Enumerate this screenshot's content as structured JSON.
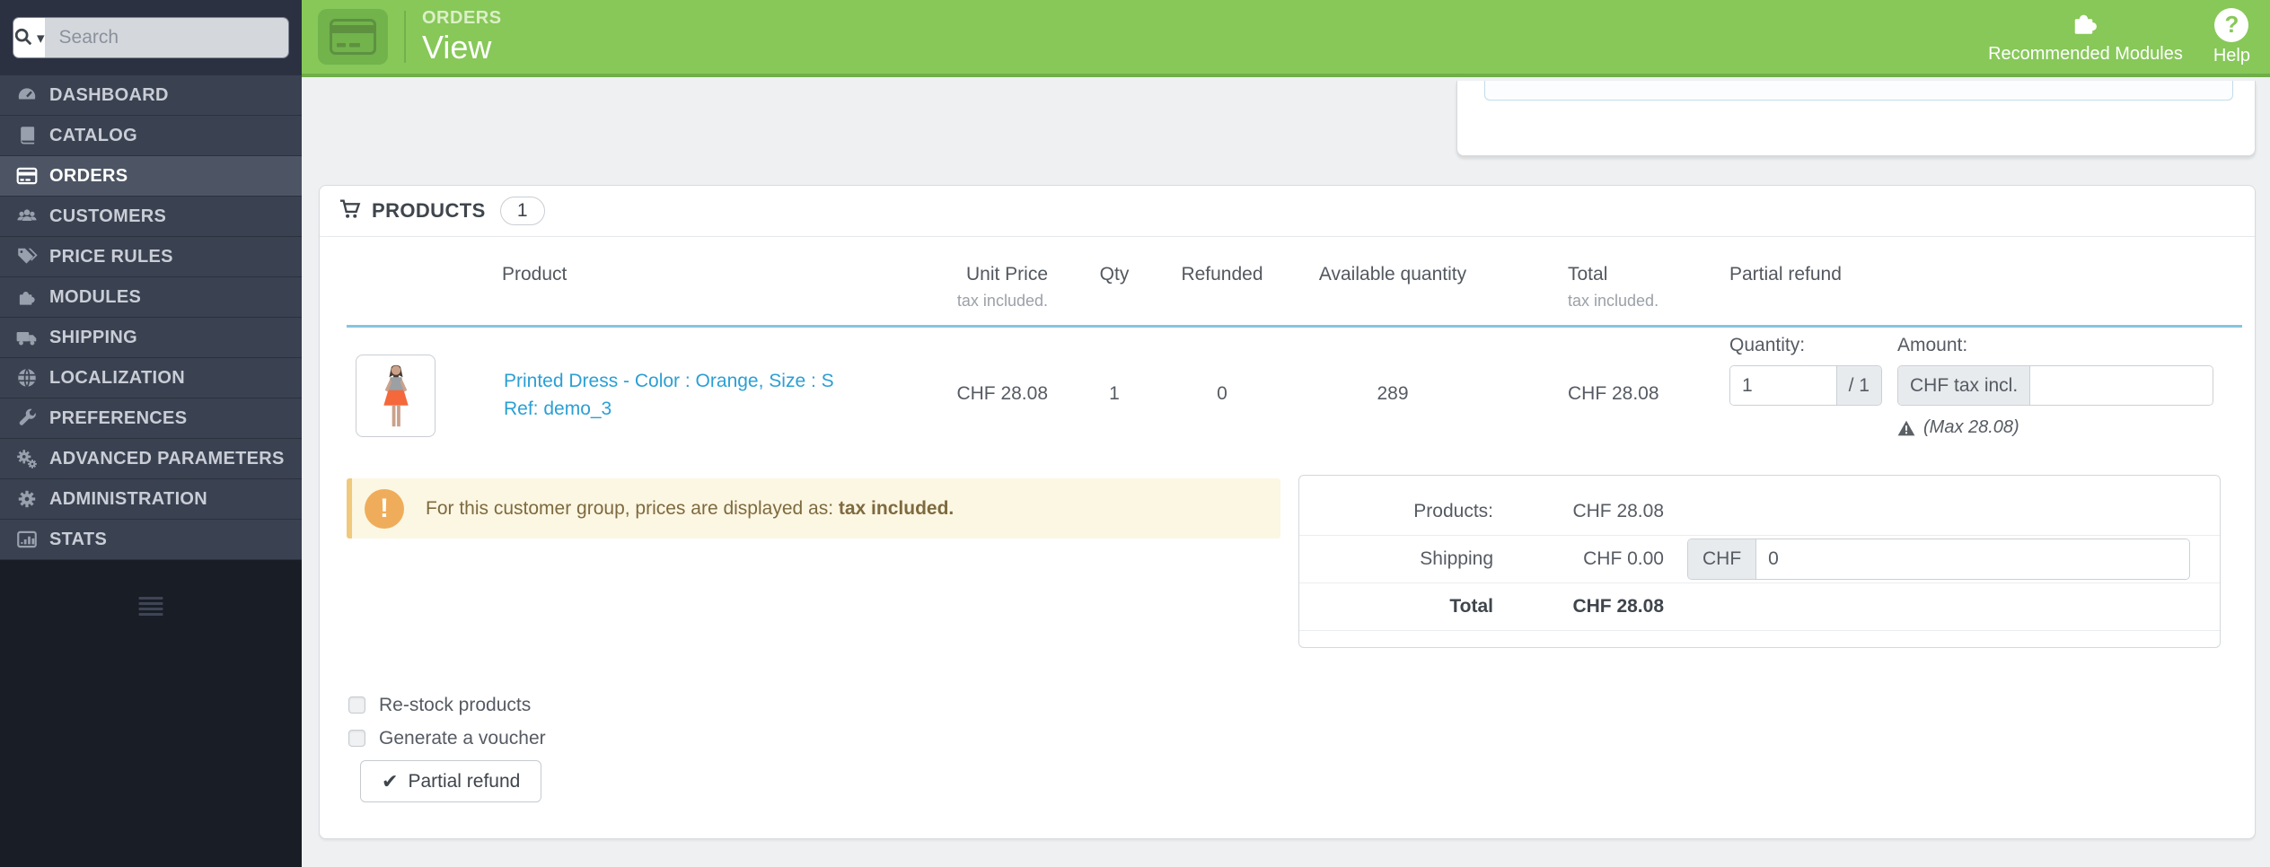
{
  "colors": {
    "accent_green": "#87c859",
    "accent_green_dark": "#6fae49",
    "icon_green_box": "#72b34c",
    "icon_green_glyph": "#5d9140",
    "sidebar_bg": "#3a4150",
    "sidebar_top_bg": "#2b3140",
    "sidebar_active_bg": "#4d5564",
    "sidebar_bottom_bg": "#191d26",
    "sidebar_text": "#c9cdd6",
    "link_blue": "#2b9fd4",
    "table_divider_blue": "#85c5de",
    "alert_bg": "#fcf7e3",
    "alert_border": "#f0c97c",
    "alert_icon_bg": "#efad5b",
    "alert_text": "#7e6a3f",
    "body_text": "#565b63",
    "heading_text": "#3f454d",
    "panel_border": "#d8dbdf",
    "content_bg": "#eef0f2"
  },
  "icons": {
    "check": "✔",
    "caret_down": "▾",
    "exclamation": "!",
    "question": "?"
  },
  "sidebar": {
    "search_placeholder": "Search",
    "items": [
      {
        "label": "DASHBOARD"
      },
      {
        "label": "CATALOG"
      },
      {
        "label": "ORDERS",
        "active": true
      },
      {
        "label": "CUSTOMERS"
      },
      {
        "label": "PRICE RULES"
      },
      {
        "label": "MODULES"
      },
      {
        "label": "SHIPPING"
      },
      {
        "label": "LOCALIZATION"
      },
      {
        "label": "PREFERENCES"
      },
      {
        "label": "ADVANCED PARAMETERS"
      },
      {
        "label": "ADMINISTRATION"
      },
      {
        "label": "STATS"
      }
    ]
  },
  "header": {
    "breadcrumb": "ORDERS",
    "title": "View",
    "actions": {
      "recommended_modules": "Recommended Modules",
      "help": "Help"
    }
  },
  "panel": {
    "title": "PRODUCTS",
    "count": "1",
    "table": {
      "headers": {
        "product": "Product",
        "unit_price": "Unit Price",
        "unit_price_sub": "tax included.",
        "qty": "Qty",
        "refunded": "Refunded",
        "available_quantity": "Available quantity",
        "total": "Total",
        "total_sub": "tax included.",
        "partial_refund": "Partial refund"
      },
      "row": {
        "product_name": "Printed Dress - Color : Orange, Size : S",
        "product_ref": "Ref: demo_3",
        "unit_price": "CHF 28.08",
        "qty": "1",
        "refunded": "0",
        "available_quantity": "289",
        "total": "CHF 28.08",
        "refund": {
          "quantity_label": "Quantity:",
          "quantity_value": "1",
          "quantity_max": "/ 1",
          "amount_label": "Amount:",
          "amount_addon": "CHF tax incl.",
          "amount_value": "",
          "max_note": "(Max 28.08)"
        }
      }
    },
    "alert": {
      "prefix": "For this customer group, prices are displayed as: ",
      "bold": "tax included."
    },
    "totals": {
      "products_label": "Products:",
      "products_value": "CHF 28.08",
      "shipping_label": "Shipping",
      "shipping_value": "CHF 0.00",
      "shipping_addon": "CHF",
      "shipping_input_value": "0",
      "total_label": "Total",
      "total_value": "CHF 28.08"
    },
    "options": {
      "restock": "Re-stock products",
      "voucher": "Generate a voucher"
    },
    "partial_refund_button": "Partial refund"
  }
}
